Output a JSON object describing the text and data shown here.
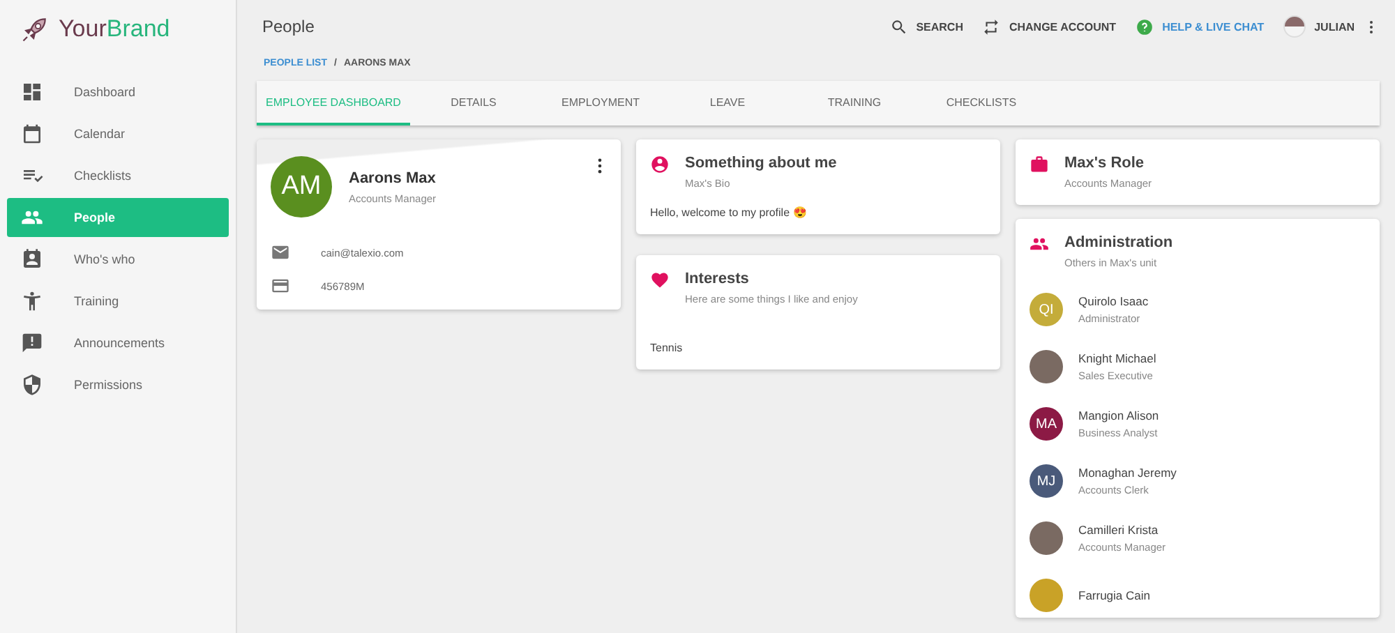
{
  "brand": {
    "part_1": "Your",
    "part_2": "Brand"
  },
  "sidebar": {
    "items": [
      {
        "label": "Dashboard",
        "selected": false
      },
      {
        "label": "Calendar",
        "selected": false
      },
      {
        "label": "Checklists",
        "selected": false
      },
      {
        "label": "People",
        "selected": true
      },
      {
        "label": "Who's who",
        "selected": false
      },
      {
        "label": "Training",
        "selected": false
      },
      {
        "label": "Announcements",
        "selected": false
      },
      {
        "label": "Permissions",
        "selected": false
      }
    ]
  },
  "header": {
    "title": "People",
    "search": "SEARCH",
    "change_account": "CHANGE ACCOUNT",
    "help": "HELP & LIVE CHAT",
    "user": "JULIAN"
  },
  "breadcrumb": {
    "link": "PEOPLE LIST",
    "separator": "/",
    "current": "AARONS MAX"
  },
  "tabs": [
    {
      "label": "EMPLOYEE DASHBOARD",
      "selected": true
    },
    {
      "label": "DETAILS",
      "selected": false
    },
    {
      "label": "EMPLOYMENT",
      "selected": false
    },
    {
      "label": "LEAVE",
      "selected": false
    },
    {
      "label": "TRAINING",
      "selected": false
    },
    {
      "label": "CHECKLISTS",
      "selected": false
    }
  ],
  "profile": {
    "initials": "AM",
    "color": "#5a8f1f",
    "name": "Aarons Max",
    "role": "Accounts Manager",
    "email": "cain@talexio.com",
    "id_number": "456789M"
  },
  "about": {
    "title": "Something about me",
    "subtitle": "Max's Bio",
    "text": "Hello, welcome to my profile 😍"
  },
  "interests": {
    "title": "Interests",
    "subtitle": "Here are some things I like and enjoy",
    "text": "Tennis"
  },
  "role": {
    "title": "Max's Role",
    "subtitle": "Accounts Manager"
  },
  "unit": {
    "title": "Administration",
    "subtitle": "Others in Max's unit",
    "members": [
      {
        "kind": "initials",
        "initials": "QI",
        "color": "#c4ac3a",
        "name": "Quirolo Isaac",
        "role": "Administrator"
      },
      {
        "kind": "photo",
        "name": "Knight Michael",
        "role": "Sales Executive"
      },
      {
        "kind": "initials",
        "initials": "MA",
        "color": "#8c1a45",
        "name": "Mangion Alison",
        "role": "Business Analyst"
      },
      {
        "kind": "initials",
        "initials": "MJ",
        "color": "#4a5a7a",
        "name": "Monaghan Jeremy",
        "role": "Accounts Clerk"
      },
      {
        "kind": "photo",
        "name": "Camilleri Krista",
        "role": "Accounts Manager"
      },
      {
        "kind": "plain",
        "color": "#c9a227",
        "name": "Farrugia Cain"
      }
    ]
  }
}
